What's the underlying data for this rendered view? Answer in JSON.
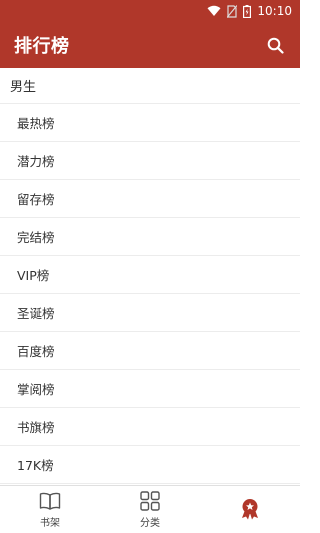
{
  "status_bar": {
    "time": "10:10",
    "icons": [
      "wifi-icon",
      "no-sim-icon",
      "battery-icon"
    ]
  },
  "app_bar": {
    "title": "排行榜",
    "search_icon": "search-icon"
  },
  "ranking": {
    "section_title": "男生",
    "items": [
      {
        "label": "最热榜"
      },
      {
        "label": "潜力榜"
      },
      {
        "label": "留存榜"
      },
      {
        "label": "完结榜"
      },
      {
        "label": "VIP榜"
      },
      {
        "label": "圣诞榜"
      },
      {
        "label": "百度榜"
      },
      {
        "label": "掌阅榜"
      },
      {
        "label": "书旗榜"
      },
      {
        "label": "17K榜"
      }
    ]
  },
  "bottom_nav": {
    "items": [
      {
        "label": "书架",
        "icon": "book-icon"
      },
      {
        "label": "分类",
        "icon": "grid-icon"
      },
      {
        "label": "",
        "icon": "award-icon",
        "active": true
      }
    ]
  },
  "colors": {
    "primary": "#b0372a",
    "text": "#333333",
    "divider": "#ececec"
  }
}
